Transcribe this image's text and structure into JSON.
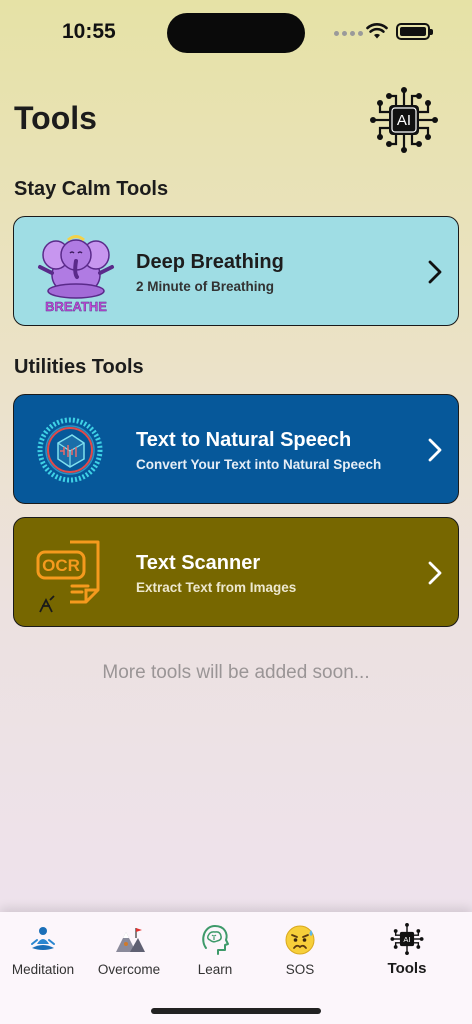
{
  "status_bar": {
    "time": "10:55"
  },
  "header": {
    "title": "Tools",
    "ai_badge": "AI"
  },
  "sections": {
    "stay_calm": "Stay Calm Tools",
    "utilities": "Utilities Tools"
  },
  "cards": {
    "breathing": {
      "title": "Deep Breathing",
      "subtitle": "2 Minute of Breathing",
      "thumb_text": "BREATHE",
      "bg": "#9fdde4"
    },
    "speech": {
      "title": "Text to Natural Speech",
      "subtitle": "Convert Your Text into Natural Speech",
      "bg": "#06589a"
    },
    "scanner": {
      "title": "Text Scanner",
      "subtitle": "Extract Text from Images",
      "thumb_text": "OCR",
      "bg": "#776700"
    }
  },
  "footer_note": "More tools will be added soon...",
  "tabs": [
    {
      "label": "Meditation",
      "icon": "meditation-icon"
    },
    {
      "label": "Overcome",
      "icon": "mountain-flag-icon"
    },
    {
      "label": "Learn",
      "icon": "brain-head-icon"
    },
    {
      "label": "SOS",
      "icon": "worried-face-icon"
    },
    {
      "label": "Tools",
      "icon": "ai-chip-icon",
      "active": true
    }
  ],
  "tab_ai_badge": "AI"
}
